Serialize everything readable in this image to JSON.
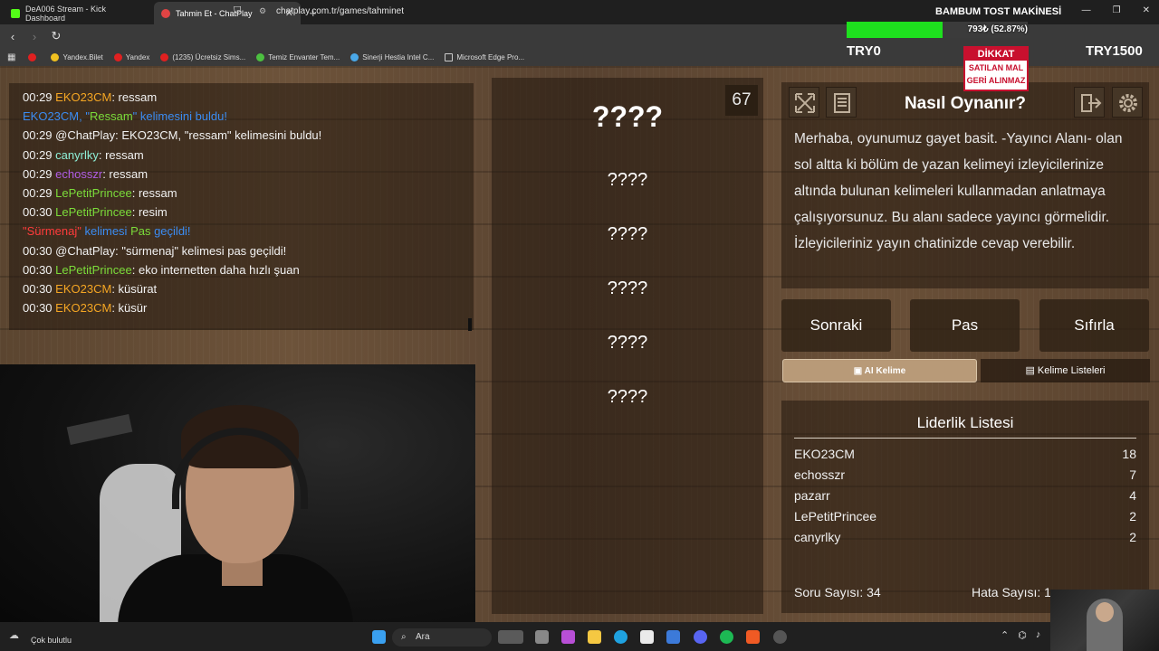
{
  "browser": {
    "tabs": [
      {
        "label": "DeA006 Stream - Kick Dashboard",
        "favicon_color": "#53fc18"
      },
      {
        "label": "Tahmin Et - ChatPlay",
        "favicon_color": "#e04444"
      }
    ],
    "window_title": "BAMBUM TOST MAKİNESİ",
    "url": "chatplay.com.tr/games/tahminet",
    "bookmarks": [
      "Yandex.Bilet",
      "Yandex",
      "(1235) Ücretsiz Sims...",
      "Temiz Envanter Tem...",
      "Sinerji Hestia Intel C...",
      "Microsoft Edge Pro..."
    ]
  },
  "overlay": {
    "goal_text": "793₺ (52.87%)",
    "progress_fraction": 0.5287,
    "min_label": "TRY0",
    "max_label": "TRY1500",
    "sign_header": "DİKKAT",
    "sign_line1": "SATILAN MAL",
    "sign_line2": "GERİ ALINMAZ"
  },
  "chat": [
    {
      "time": "00:29",
      "user": "EKO23CM",
      "user_color": "orange",
      "msg": ": ressam"
    },
    {
      "system": true,
      "segments": [
        {
          "text": "EKO23CM, \"",
          "color": "blue"
        },
        {
          "text": "Ressam",
          "color": "green"
        },
        {
          "text": "\" kelimesini buldu!",
          "color": "blue"
        }
      ]
    },
    {
      "time": "00:29",
      "user": "@ChatPlay",
      "user_color": "white",
      "msg": ": EKO23CM, \"ressam\" kelimesini buldu!"
    },
    {
      "time": "00:29",
      "user": "canyrlky",
      "user_color": "teal",
      "msg": ": ressam"
    },
    {
      "time": "00:29",
      "user": "echosszr",
      "user_color": "purple",
      "msg": ": ressam"
    },
    {
      "time": "00:29",
      "user": "LePetitPrincee",
      "user_color": "green",
      "msg": ": ressam"
    },
    {
      "time": "00:30",
      "user": "LePetitPrincee",
      "user_color": "green",
      "msg": ": resim"
    },
    {
      "system": true,
      "segments": [
        {
          "text": "\"Sürmenaj\"",
          "color": "red"
        },
        {
          "text": " kelimesi ",
          "color": "blue"
        },
        {
          "text": "Pas",
          "color": "green"
        },
        {
          "text": " geçildi!",
          "color": "blue"
        }
      ]
    },
    {
      "time": "00:30",
      "user": "@ChatPlay",
      "user_color": "white",
      "msg": ": \"sürmenaj\" kelimesi pas geçildi!"
    },
    {
      "time": "00:30",
      "user": "LePetitPrincee",
      "user_color": "green",
      "msg": ": eko internetten daha hızlı şuan"
    },
    {
      "time": "00:30",
      "user": "EKO23CM",
      "user_color": "orange",
      "msg": ": küsürat"
    },
    {
      "time": "00:30",
      "user": "EKO23CM",
      "user_color": "orange",
      "msg": ": küsür"
    }
  ],
  "game": {
    "timer": "67",
    "words": [
      "????",
      "????",
      "????",
      "????",
      "????",
      "????"
    ]
  },
  "howto": {
    "title": "Nasıl Oynanır?",
    "body": "Merhaba, oyunumuz gayet basit. -Yayıncı Alanı- olan sol altta ki bölüm de yazan kelimeyi izleyicilerinize altında bulunan kelimeleri kullanmadan anlatmaya çalışıyorsunuz. Bu alanı sadece yayıncı görmelidir. İzleyicileriniz yayın chatinizde cevap verebilir."
  },
  "buttons": {
    "next": "Sonraki",
    "pass": "Pas",
    "reset": "Sıfırla"
  },
  "tabs": {
    "ai_word": "AI Kelime",
    "word_lists": "Kelime Listeleri"
  },
  "leaderboard": {
    "title": "Liderlik Listesi",
    "rows": [
      {
        "name": "EKO23CM",
        "score": "18"
      },
      {
        "name": "echosszr",
        "score": "7"
      },
      {
        "name": "pazarr",
        "score": "4"
      },
      {
        "name": "LePetitPrincee",
        "score": "2"
      },
      {
        "name": "canyrlky",
        "score": "2"
      }
    ],
    "question_count": "Soru Sayısı: 34",
    "error_count": "Hata Sayısı: 1"
  },
  "taskbar": {
    "weather": "Çok bulutlu",
    "search": "Ara"
  },
  "colors": {
    "orange": "#f5a623",
    "green": "#7bdc3a",
    "purple": "#b05ce6",
    "teal": "#8ef0d8",
    "blue": "#3b8cf2",
    "red": "#ff3b3b",
    "white": "#f2f2f2",
    "progress": "#1ee01e"
  }
}
